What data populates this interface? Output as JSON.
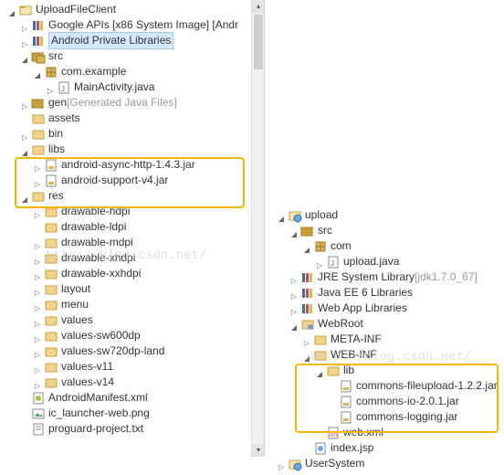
{
  "watermark1": "http://blog.csdn.net/",
  "watermark2": "http://blog.csdn.net/",
  "left": {
    "project": "UploadFileClient",
    "googleApis": "Google APIs [x86 System Image] [Andr",
    "androidPriv": "Android Private Libraries",
    "src": "src",
    "pkg": "com.example",
    "mainActivity": "MainActivity.java",
    "gen": "gen",
    "genDeco": " [Generated Java Files]",
    "assets": "assets",
    "bin": "bin",
    "libs": "libs",
    "jar1": "android-async-http-1.4.3.jar",
    "jar2": "android-support-v4.jar",
    "res": "res",
    "dhdpi": "drawable-hdpi",
    "dldpi": "drawable-ldpi",
    "dmdpi": "drawable-mdpi",
    "dxhdpi": "drawable-xhdpi",
    "dxxhdpi": "drawable-xxhdpi",
    "layout": "layout",
    "menu": "menu",
    "values": "values",
    "vsw600": "values-sw600dp",
    "vsw720": "values-sw720dp-land",
    "v11": "values-v11",
    "v14": "values-v14",
    "manifest": "AndroidManifest.xml",
    "launcher": "ic_launcher-web.png",
    "proguard": "proguard-project.txt"
  },
  "right": {
    "project": "upload",
    "src": "src",
    "pkg": "com",
    "uploadJava": "upload.java",
    "jre": "JRE System Library",
    "jreDeco": " [jdk1.7.0_67]",
    "javaee": "Java EE 6 Libraries",
    "webapp": "Web App Libraries",
    "webroot": "WebRoot",
    "metainf": "META-INF",
    "webinf": "WEB-INF",
    "lib": "lib",
    "jar1": "commons-fileupload-1.2.2.jar",
    "jar2": "commons-io-2.0.1.jar",
    "jar3": "commons-logging.jar",
    "webxml": "web.xml",
    "indexjsp": "index.jsp",
    "usersys": "UserSystem"
  }
}
